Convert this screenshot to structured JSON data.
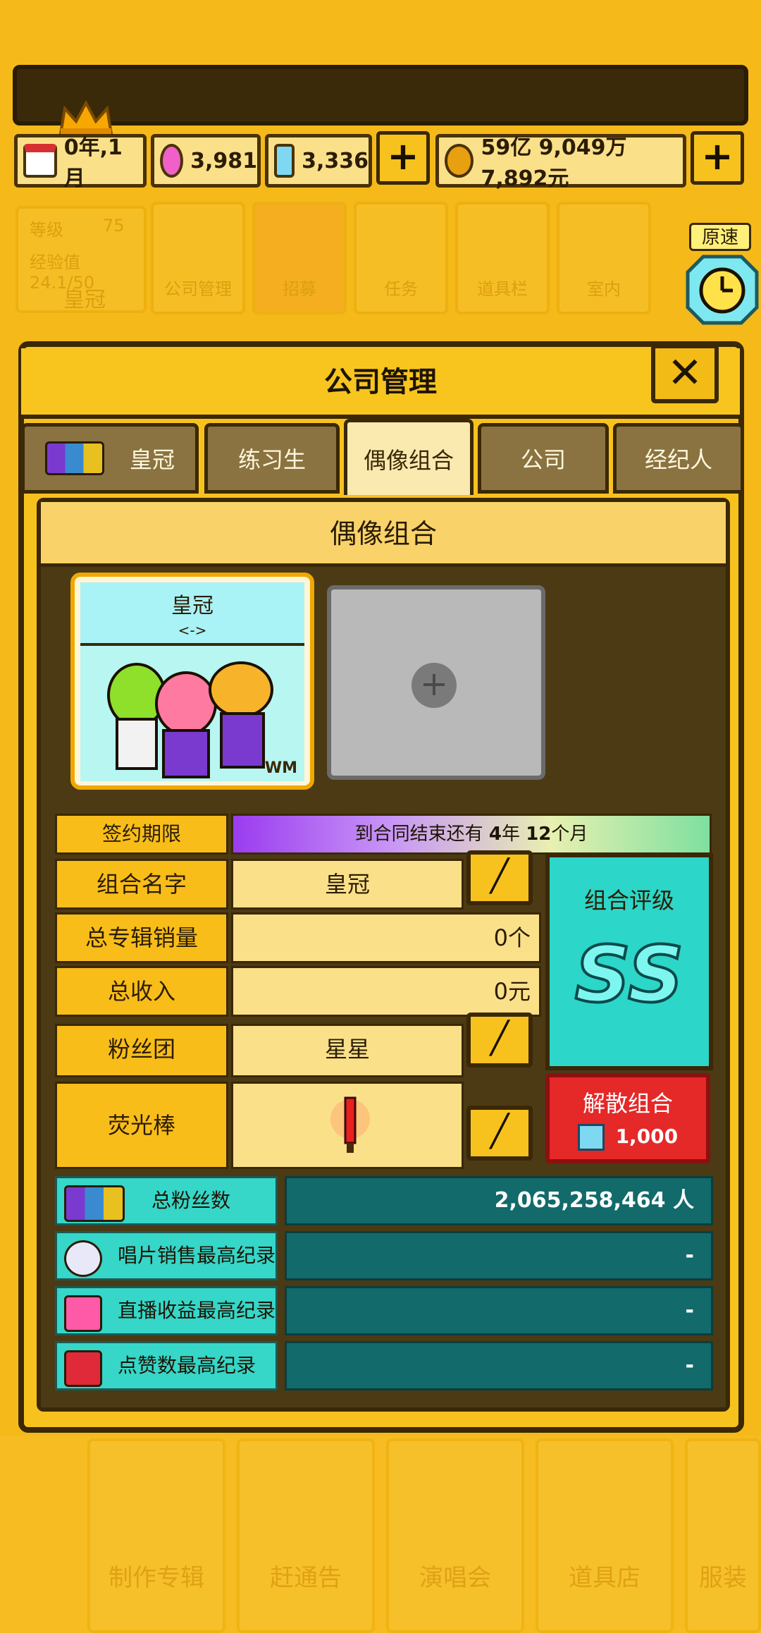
{
  "header": {
    "date": "0年,1月",
    "gems_pink": "3,981",
    "diamonds": "3,336",
    "money": "59亿 9,049万 7,892元",
    "plus_label": "+"
  },
  "bg_menu": {
    "level_label": "等级",
    "level_value": "75",
    "exp_label": "经验值 24.1/50",
    "crown_label": "皇冠",
    "items": [
      "公司管理",
      "招募",
      "任务",
      "道具栏",
      "室内"
    ]
  },
  "speed": {
    "label": "原速"
  },
  "panel": {
    "title": "公司管理",
    "close_label": "✕",
    "tabs": [
      "皇冠",
      "练习生",
      "偶像组合",
      "公司",
      "经纪人"
    ],
    "section_title": "偶像组合",
    "card": {
      "name": "皇冠",
      "sub": "<->",
      "badge": "WM"
    },
    "empty_plus": "+",
    "contract": {
      "label": "签约期限",
      "text_pre": "到合同结束还有",
      "years": "4",
      "y_unit": "年",
      "months": "12",
      "m_unit": "个月"
    },
    "rows": [
      {
        "label": "组合名字",
        "value": "皇冠"
      },
      {
        "label": "总专辑销量",
        "value": "0个"
      },
      {
        "label": "总收入",
        "value": "0元"
      },
      {
        "label": "粉丝团",
        "value": "星星"
      },
      {
        "label": "荧光棒",
        "value": ""
      }
    ],
    "rating": {
      "label": "组合评级",
      "grade": "SS"
    },
    "disband": {
      "label": "解散组合",
      "cost": "1,000"
    },
    "stats": [
      {
        "label": "总粉丝数",
        "value": "2,065,258,464 人",
        "icon": "fans-icon"
      },
      {
        "label": "唱片销售最高纪录",
        "value": "-",
        "icon": "disc-icon"
      },
      {
        "label": "直播收益最高纪录",
        "value": "-",
        "icon": "music-note-icon"
      },
      {
        "label": "点赞数最高纪录",
        "value": "-",
        "icon": "play-icon"
      }
    ]
  },
  "bottom_menu": [
    "制作专辑",
    "赶通告",
    "演唱会",
    "道具店",
    "服装"
  ],
  "colors": {
    "accent": "#f5b91a",
    "teal": "#126a6a",
    "red": "#e52828",
    "dark": "#3a2806"
  }
}
